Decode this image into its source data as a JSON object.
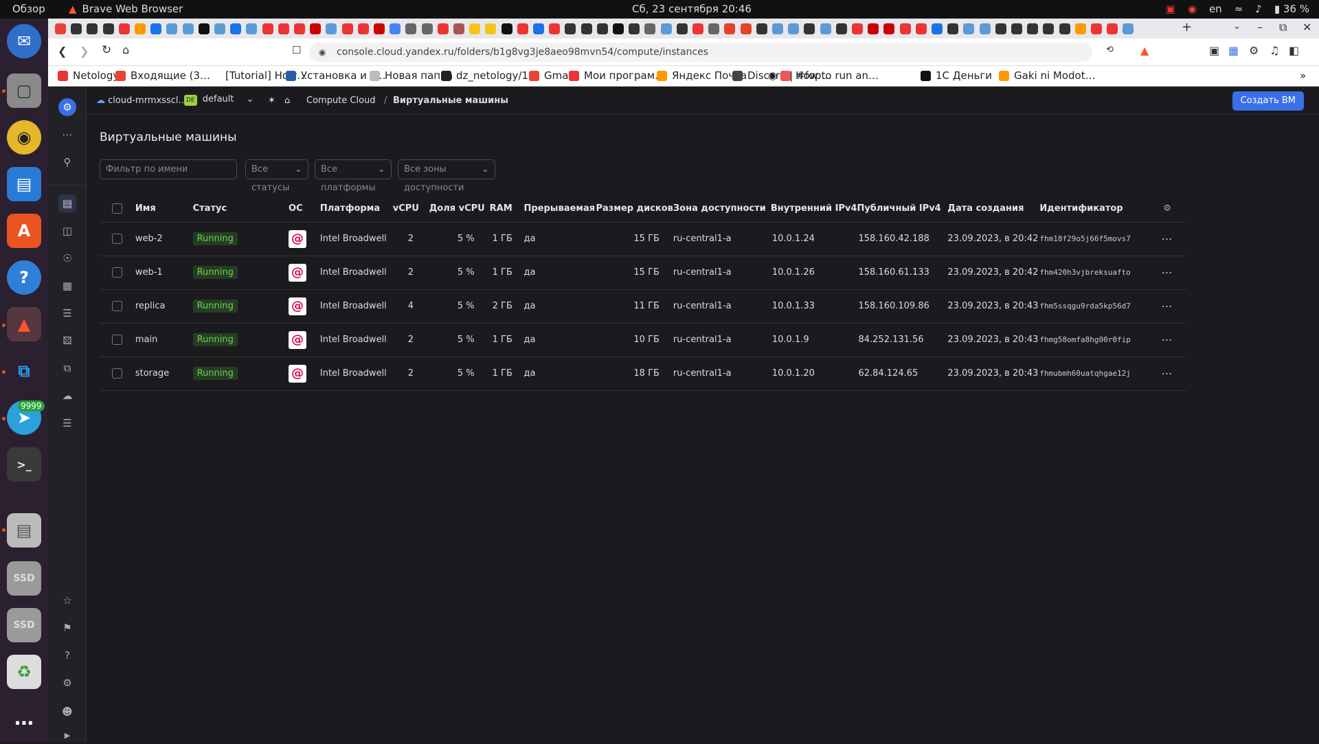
{
  "system": {
    "overview": "Обзор",
    "app_name": "Brave Web Browser",
    "clock": "Сб, 23 сентября  20:46",
    "lang": "en",
    "battery": "36 %"
  },
  "dock": {
    "telegram_badge": "9999",
    "ssd1": "SSD",
    "ssd2": "SSD"
  },
  "browser": {
    "url": "console.cloud.yandex.ru/folders/b1g8vg3je8aeo98mvn54/compute/instances",
    "bookmarks": [
      {
        "label": "Netology"
      },
      {
        "label": "Входящие (3…"
      },
      {
        "label": "[Tutorial] How…"
      },
      {
        "label": "Установка и з…"
      },
      {
        "label": "Новая папка"
      },
      {
        "label": "dz_netology/1…"
      },
      {
        "label": "Gmail"
      },
      {
        "label": "Мои програм…"
      },
      {
        "label": "Яндекс Почта"
      },
      {
        "label": "Discord | #fop…"
      },
      {
        "label": "How to run an…"
      },
      {
        "label": "1С Деньги"
      },
      {
        "label": "Gaki ni Modot…"
      }
    ]
  },
  "console": {
    "cloud_name": "cloud-mrmxsscl…",
    "folder_badge": "DE",
    "folder_name": "default",
    "breadcrumb_service": "Compute Cloud",
    "breadcrumb_sep": "/",
    "breadcrumb_page": "Виртуальные машины",
    "create_button": "Создать ВМ",
    "page_title": "Виртуальные машины",
    "filter_placeholder": "Фильтр по имени",
    "status_filter": "Все статусы",
    "platform_filter": "Все платформы",
    "zone_filter": "Все зоны доступности"
  },
  "table": {
    "columns": [
      "Имя",
      "Статус",
      "ОС",
      "Платформа",
      "vCPU",
      "Доля vCPU",
      "RAM",
      "Прерываемая",
      "Размер дисков",
      "Зона доступности",
      "Внутренний IPv4",
      "Публичный IPv4",
      "Дата создания",
      "Идентификатор"
    ],
    "rows": [
      {
        "name": "web-2",
        "status": "Running",
        "platform": "Intel Broadwell",
        "vcpu": "2",
        "share": "5 %",
        "ram": "1 ГБ",
        "preempt": "да",
        "disk": "15 ГБ",
        "zone": "ru-central1-a",
        "ipv4_int": "10.0.1.24",
        "ipv4_pub": "158.160.42.188",
        "created": "23.09.2023, в 20:42",
        "id": "fhm18f29o5j66f5movs7"
      },
      {
        "name": "web-1",
        "status": "Running",
        "platform": "Intel Broadwell",
        "vcpu": "2",
        "share": "5 %",
        "ram": "1 ГБ",
        "preempt": "да",
        "disk": "15 ГБ",
        "zone": "ru-central1-a",
        "ipv4_int": "10.0.1.26",
        "ipv4_pub": "158.160.61.133",
        "created": "23.09.2023, в 20:42",
        "id": "fhm420h3vjbreksuafto"
      },
      {
        "name": "replica",
        "status": "Running",
        "platform": "Intel Broadwell",
        "vcpu": "4",
        "share": "5 %",
        "ram": "2 ГБ",
        "preempt": "да",
        "disk": "11 ГБ",
        "zone": "ru-central1-a",
        "ipv4_int": "10.0.1.33",
        "ipv4_pub": "158.160.109.86",
        "created": "23.09.2023, в 20:43",
        "id": "fhm5ssqgu9rda5kp56d7"
      },
      {
        "name": "main",
        "status": "Running",
        "platform": "Intel Broadwell",
        "vcpu": "2",
        "share": "5 %",
        "ram": "1 ГБ",
        "preempt": "да",
        "disk": "10 ГБ",
        "zone": "ru-central1-a",
        "ipv4_int": "10.0.1.9",
        "ipv4_pub": "84.252.131.56",
        "created": "23.09.2023, в 20:43",
        "id": "fhmg58omfa8hg00r0fip"
      },
      {
        "name": "storage",
        "status": "Running",
        "platform": "Intel Broadwell",
        "vcpu": "2",
        "share": "5 %",
        "ram": "1 ГБ",
        "preempt": "да",
        "disk": "18 ГБ",
        "zone": "ru-central1-a",
        "ipv4_int": "10.0.1.20",
        "ipv4_pub": "62.84.124.65",
        "created": "23.09.2023, в 20:43",
        "id": "fhmubmh60uatqhgae12j"
      }
    ]
  },
  "colors": {
    "accent": "#3a6fe8",
    "status_running": "#6ccf5a",
    "debian": "#d70a53"
  }
}
